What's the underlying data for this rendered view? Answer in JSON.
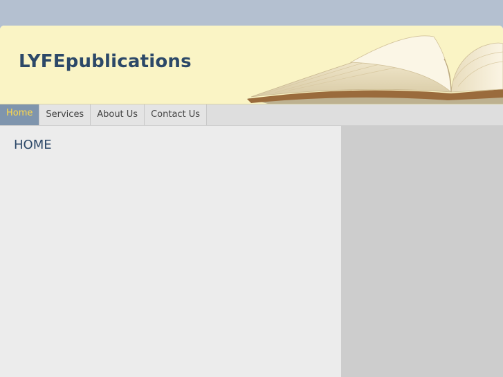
{
  "site": {
    "title": "LYFEpublications"
  },
  "nav": {
    "items": [
      {
        "label": "Home",
        "active": true
      },
      {
        "label": "Services",
        "active": false
      },
      {
        "label": "About Us",
        "active": false
      },
      {
        "label": "Contact Us",
        "active": false
      }
    ]
  },
  "main": {
    "heading": "HOME"
  },
  "colors": {
    "background": "#b4c0d0",
    "header": "#faf4c5",
    "title": "#2c4868",
    "nav_active": "#7f95ad",
    "nav_active_text": "#ffd94a",
    "sidebar": "#cdcdcd"
  }
}
